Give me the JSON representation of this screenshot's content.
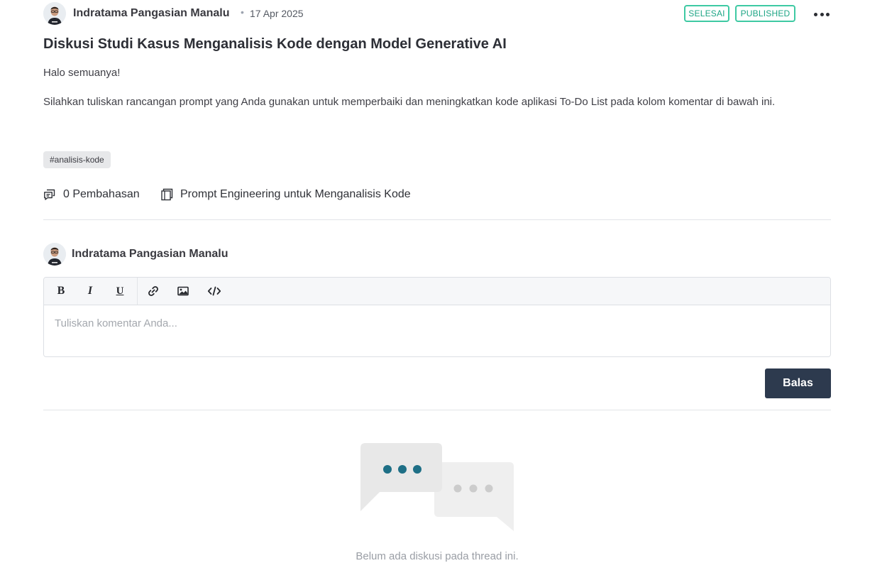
{
  "post": {
    "author": "Indratama Pangasian Manalu",
    "separator": "•",
    "date": "17 Apr 2025",
    "badges": [
      "SELESAI",
      "PUBLISHED"
    ],
    "title": "Diskusi Studi Kasus Menganalisis Kode dengan Model Generative AI",
    "greeting": "Halo semuanya!",
    "body": "Silahkan tuliskan rancangan prompt yang Anda gunakan untuk memperbaiki dan meningkatkan kode aplikasi To-Do List pada kolom komentar di bawah ini.",
    "tag": "#analisis-kode",
    "discussion_count_label": "0 Pembahasan",
    "module_label": "Prompt Engineering untuk Menganalisis Kode"
  },
  "reply": {
    "author": "Indratama Pangasian Manalu",
    "toolbar": {
      "bold": "B",
      "italic": "I",
      "underline": "U"
    },
    "placeholder": "Tuliskan komentar Anda...",
    "submit_label": "Balas"
  },
  "empty_state": {
    "message": "Belum ada diskusi pada thread ini."
  },
  "colors": {
    "badge_accent": "#3ec9a3",
    "primary_button": "#2d3a4e",
    "illustration_dots": "#1e6f86"
  },
  "icons": [
    "avatar",
    "more-dots-icon",
    "chat-bubbles-icon",
    "module-book-icon",
    "bold-icon",
    "italic-icon",
    "underline-icon",
    "link-icon",
    "image-icon",
    "code-icon",
    "empty-chat-illustration"
  ]
}
